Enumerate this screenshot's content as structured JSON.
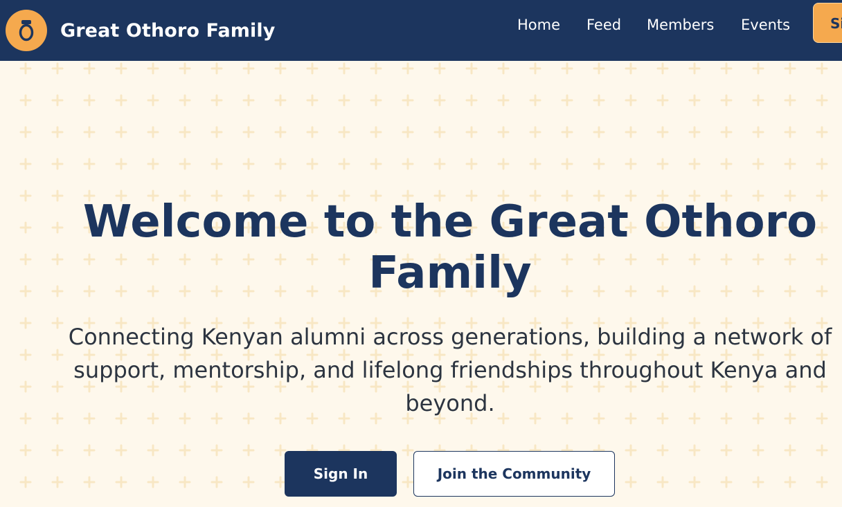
{
  "colors": {
    "navbar_bg": "#1c355e",
    "accent": "#f5a94e",
    "hero_bg": "#fef8ec",
    "pattern": "#f8e7c4"
  },
  "header": {
    "logo_icon": "o-letter-icon",
    "site_name": "Great Othoro Family",
    "nav": {
      "home": "Home",
      "feed": "Feed",
      "members": "Members",
      "events": "Events"
    },
    "signup_label": "Si"
  },
  "hero": {
    "title": "Welcome to the Great Othoro Family",
    "subtitle": "Connecting Kenyan alumni across generations, building a network of support, mentorship, and lifelong friendships throughout Kenya and beyond.",
    "primary_button": "Sign In",
    "secondary_button": "Join the Community",
    "background_pattern_icon": "plus-pattern-icon"
  }
}
